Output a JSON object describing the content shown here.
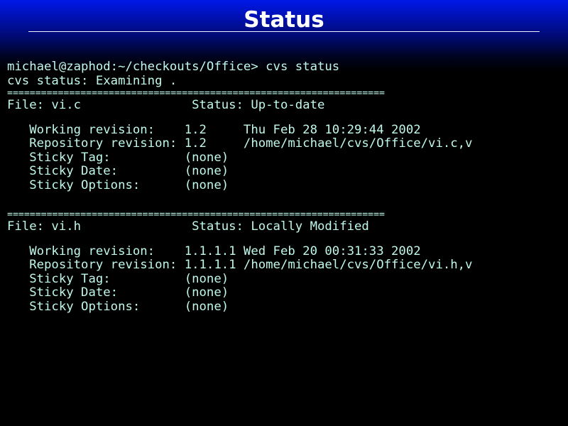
{
  "title": "Status",
  "terminal": {
    "prompt_line": "michael@zaphod:~/checkouts/Office> cvs status",
    "examining_line": "cvs status: Examining .",
    "separator": "===================================================================",
    "files": [
      {
        "file_line": "File: vi.c               Status: Up-to-date",
        "working_revision": "   Working revision:    1.2     Thu Feb 28 10:29:44 2002",
        "repository_revision": "   Repository revision: 1.2     /home/michael/cvs/Office/vi.c,v",
        "sticky_tag": "   Sticky Tag:          (none)",
        "sticky_date": "   Sticky Date:         (none)",
        "sticky_options": "   Sticky Options:      (none)"
      },
      {
        "file_line": "File: vi.h               Status: Locally Modified",
        "working_revision": "   Working revision:    1.1.1.1 Wed Feb 20 00:31:33 2002",
        "repository_revision": "   Repository revision: 1.1.1.1 /home/michael/cvs/Office/vi.h,v",
        "sticky_tag": "   Sticky Tag:          (none)",
        "sticky_date": "   Sticky Date:         (none)",
        "sticky_options": "   Sticky Options:      (none)"
      }
    ]
  },
  "colors": {
    "title_text": "#ffffff",
    "terminal_text": "#bff8ea",
    "background": "#000000",
    "header_gradient_top": "#0018e8"
  }
}
